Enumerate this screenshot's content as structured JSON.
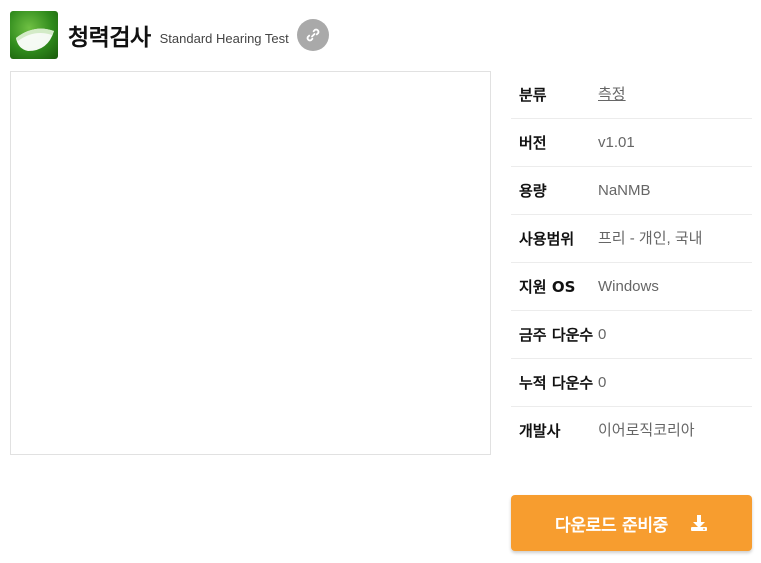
{
  "app": {
    "title": "청력검사",
    "subtitle": "Standard Hearing Test",
    "logo_icon": "hearing-test-logo",
    "link_icon": "link-icon"
  },
  "info_rows": [
    {
      "key": "분류",
      "value": "측정"
    },
    {
      "key": "버전",
      "value": "v1.01"
    },
    {
      "key": "용량",
      "value": "NaNMB"
    },
    {
      "key": "사용범위",
      "value": "프리 - 개인, 국내"
    },
    {
      "key": "지원 OS",
      "value": "Windows"
    },
    {
      "key": "금주 다운수",
      "value": "0"
    },
    {
      "key": "누적 다운수",
      "value": "0"
    },
    {
      "key": "개발사",
      "value": "이어로직코리아"
    }
  ],
  "download": {
    "label": "다운로드 준비중",
    "icon": "download-icon"
  },
  "colors": {
    "accent": "#f79d2f",
    "link_button": "#a9a9a9",
    "value_text": "#666666"
  }
}
